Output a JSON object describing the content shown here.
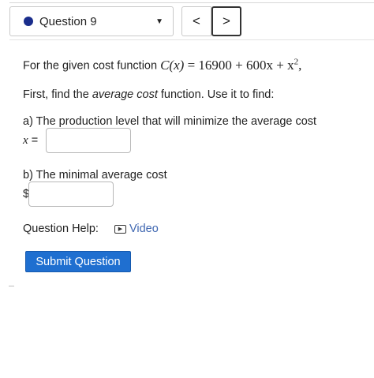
{
  "question_nav": {
    "question_label": "Question 9",
    "prev_glyph": "<",
    "next_glyph": ">",
    "dot_color": "#1a2d8c"
  },
  "problem": {
    "intro": "For the given cost function ",
    "function_lhs": "C(x)",
    "function_rhs": "16900 + 600x + x",
    "exponent": "2",
    "trailing": ",",
    "instruction_prefix": "First, find the ",
    "instruction_emph": "average cost",
    "instruction_suffix": " function. Use it to find:"
  },
  "part_a": {
    "prompt": "a) The production level that will minimize the average cost",
    "var_label": "x",
    "equals": "=",
    "value": ""
  },
  "part_b": {
    "prompt": "b) The minimal average cost",
    "currency": "$",
    "value": ""
  },
  "help": {
    "label": "Question Help:",
    "video_label": "Video",
    "video_icon": "play-icon"
  },
  "submit_label": "Submit Question",
  "colors": {
    "link": "#3f67b1",
    "submit_bg": "#1f6fd0"
  }
}
